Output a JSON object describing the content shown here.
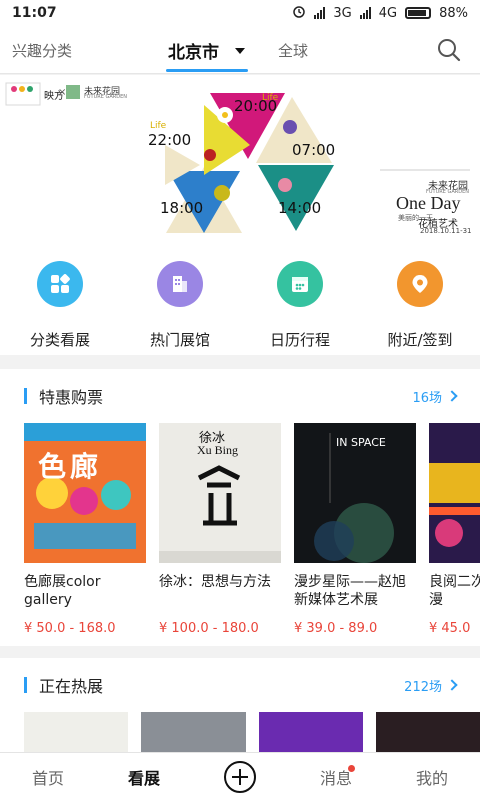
{
  "status_bar": {
    "time": "11:07",
    "network_1": "3G",
    "network_2": "4G",
    "battery": "88%"
  },
  "top_nav": {
    "interest_categories": "兴趣分类",
    "city": "北京市",
    "global": "全球"
  },
  "banner": {
    "partner_logo_left": "映方",
    "cross": "×",
    "partner_logo_right": "未来花园",
    "partner_logo_right_en": "FUTURE GARDEN",
    "times": [
      "20:00",
      "07:00",
      "14:00",
      "18:00",
      "22:00"
    ],
    "life_label": "Life",
    "brand_cn": "未来花园",
    "brand_en": "FUTURE GARDEN",
    "event_title": "One Day",
    "event_sub": "美丽的一天",
    "event_art": "花植艺术",
    "event_date": "2018.10.11-31"
  },
  "quick_entries": [
    {
      "label": "分类看展",
      "icon": "category-icon",
      "color": "#3bb8ee"
    },
    {
      "label": "热门展馆",
      "icon": "building-icon",
      "color": "#9a86e4"
    },
    {
      "label": "日历行程",
      "icon": "calendar-icon",
      "color": "#35c2a0"
    },
    {
      "label": "附近/签到",
      "icon": "location-icon",
      "color": "#f2962e"
    }
  ],
  "ticket_section": {
    "title": "特惠购票",
    "count": "16场",
    "items": [
      {
        "name": "色廊展color gallery",
        "price": "¥ 50.0 - 168.0",
        "poster_text": "色廊"
      },
      {
        "name": "徐冰：思想与方法",
        "price": "¥ 100.0 - 180.0",
        "poster_text": "徐冰",
        "poster_sub": "Xu Bing"
      },
      {
        "name": "漫步星际——赵旭新媒体艺术展",
        "price": "¥ 39.0 - 89.0",
        "poster_text": "IN SPACE"
      },
      {
        "name": "良阅二次元圣节动漫",
        "price": "¥ 45.0"
      }
    ]
  },
  "hot_section": {
    "title": "正在热展",
    "count": "212场"
  },
  "tab_bar": {
    "home": "首页",
    "exhibitions": "看展",
    "messages": "消息",
    "mine": "我的"
  }
}
